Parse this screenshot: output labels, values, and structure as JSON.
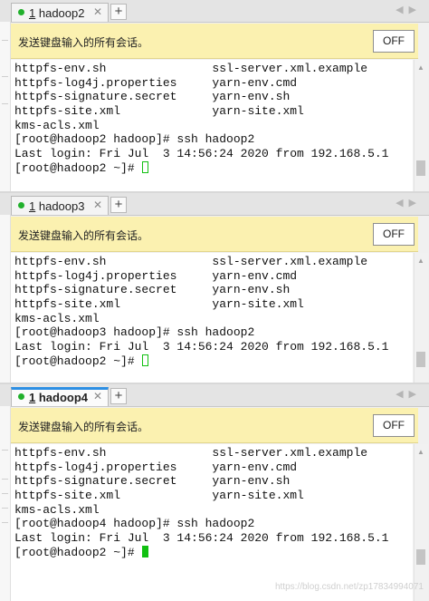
{
  "infobar_message": "发送键盘输入的所有会话。",
  "off_label": "OFF",
  "add_tab_label": "+",
  "close_glyph": "✕",
  "watermark": "https://blog.csdn.net/zp17834994071",
  "panes": [
    {
      "tab": {
        "number": "1",
        "name": "hadoop2",
        "active": false
      },
      "lines": [
        "httpfs-env.sh               ssl-server.xml.example",
        "httpfs-log4j.properties     yarn-env.cmd",
        "httpfs-signature.secret     yarn-env.sh",
        "httpfs-site.xml             yarn-site.xml",
        "kms-acls.xml",
        "[root@hadoop2 hadoop]# ssh hadoop2",
        "Last login: Fri Jul  3 14:56:24 2020 from 192.168.5.1"
      ],
      "prompt": "[root@hadoop2 ~]# "
    },
    {
      "tab": {
        "number": "1",
        "name": "hadoop3",
        "active": false
      },
      "lines": [
        "httpfs-env.sh               ssl-server.xml.example",
        "httpfs-log4j.properties     yarn-env.cmd",
        "httpfs-signature.secret     yarn-env.sh",
        "httpfs-site.xml             yarn-site.xml",
        "kms-acls.xml",
        "[root@hadoop3 hadoop]# ssh hadoop2",
        "Last login: Fri Jul  3 14:56:24 2020 from 192.168.5.1"
      ],
      "prompt": "[root@hadoop2 ~]# "
    },
    {
      "tab": {
        "number": "1",
        "name": "hadoop4",
        "active": true
      },
      "lines": [
        "httpfs-env.sh               ssl-server.xml.example",
        "httpfs-log4j.properties     yarn-env.cmd",
        "httpfs-signature.secret     yarn-env.sh",
        "httpfs-site.xml             yarn-site.xml",
        "kms-acls.xml",
        "[root@hadoop4 hadoop]# ssh hadoop2",
        "Last login: Fri Jul  3 14:56:24 2020 from 192.168.5.1"
      ],
      "prompt": "[root@hadoop2 ~]# "
    }
  ],
  "colors": {
    "tab_active_accent": "#2d8fe3",
    "tab_dot": "#21b02c",
    "cursor": "#11c011",
    "infobar_bg": "#fbf1b0"
  }
}
